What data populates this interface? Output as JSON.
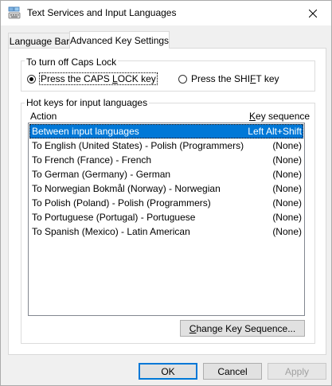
{
  "window": {
    "title": "Text Services and Input Languages",
    "icon": "keyboard-icon",
    "close_icon": "close-icon"
  },
  "tabs": [
    {
      "label": "Language Bar",
      "active": false
    },
    {
      "label": "Advanced Key Settings",
      "active": true
    }
  ],
  "caps_lock": {
    "legend": "To turn off Caps Lock",
    "option1": {
      "pre": "Press the CAPS ",
      "accel": "L",
      "post": "OCK key",
      "checked": true
    },
    "option2": {
      "pre": "Press the SHI",
      "accel": "F",
      "post": "T key",
      "checked": false
    }
  },
  "hotkeys": {
    "legend": "Hot keys for input languages",
    "col_action": "Action",
    "col_sequence_accel": "K",
    "col_sequence_rest": "ey sequence",
    "rows": [
      {
        "action": "Between input languages",
        "sequence": "Left Alt+Shift",
        "selected": true
      },
      {
        "action": "To English (United States) - Polish (Programmers)",
        "sequence": "(None)",
        "selected": false
      },
      {
        "action": "To French (France) - French",
        "sequence": "(None)",
        "selected": false
      },
      {
        "action": "To German (Germany) - German",
        "sequence": "(None)",
        "selected": false
      },
      {
        "action": "To Norwegian Bokmål (Norway) - Norwegian",
        "sequence": "(None)",
        "selected": false
      },
      {
        "action": "To Polish (Poland) - Polish (Programmers)",
        "sequence": "(None)",
        "selected": false
      },
      {
        "action": "To Portuguese (Portugal) - Portuguese",
        "sequence": "(None)",
        "selected": false
      },
      {
        "action": "To Spanish (Mexico) - Latin American",
        "sequence": "(None)",
        "selected": false
      }
    ],
    "change_button": {
      "accel": "C",
      "rest": "hange Key Sequence..."
    }
  },
  "footer": {
    "ok": "OK",
    "cancel": "Cancel",
    "apply": "Apply",
    "apply_enabled": false
  },
  "colors": {
    "selection": "#0078d7",
    "default_button_border": "#0078d7"
  }
}
